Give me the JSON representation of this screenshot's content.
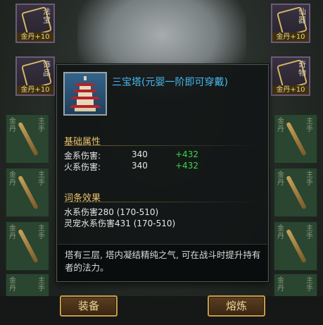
{
  "equip_slots": [
    {
      "tag": "金丹+10",
      "label": "法宝"
    },
    {
      "tag": "金丹+10",
      "label": "仙器"
    },
    {
      "tag": "金丹+10",
      "label": "饰品"
    },
    {
      "tag": "金丹+10",
      "label": "奇物"
    }
  ],
  "grid_cell_label_left": "金丹",
  "grid_cell_label_right": "主手",
  "tooltip": {
    "title": "三宝塔(元婴一阶即可穿戴)",
    "base_section": "基础属性",
    "stats": [
      {
        "label": "金系伤害:",
        "value": "340",
        "bonus": "+432"
      },
      {
        "label": "火系伤害:",
        "value": "340",
        "bonus": "+432"
      }
    ],
    "affix_section": "词条效果",
    "affixes": [
      "水系伤害280 (170-510)",
      "灵宠水系伤害431 (170-510)"
    ],
    "description": "塔有三层, 塔内凝结精纯之气, 可在战斗时提升持有者的法力。"
  },
  "buttons": {
    "equip": "装备",
    "refine": "熔炼"
  },
  "colors": {
    "title": "#48b8f0",
    "section": "#e8c36a",
    "bonus": "#3cd64a"
  },
  "icons": {
    "item": "pagoda-icon",
    "grid_item": "flute-icon"
  }
}
